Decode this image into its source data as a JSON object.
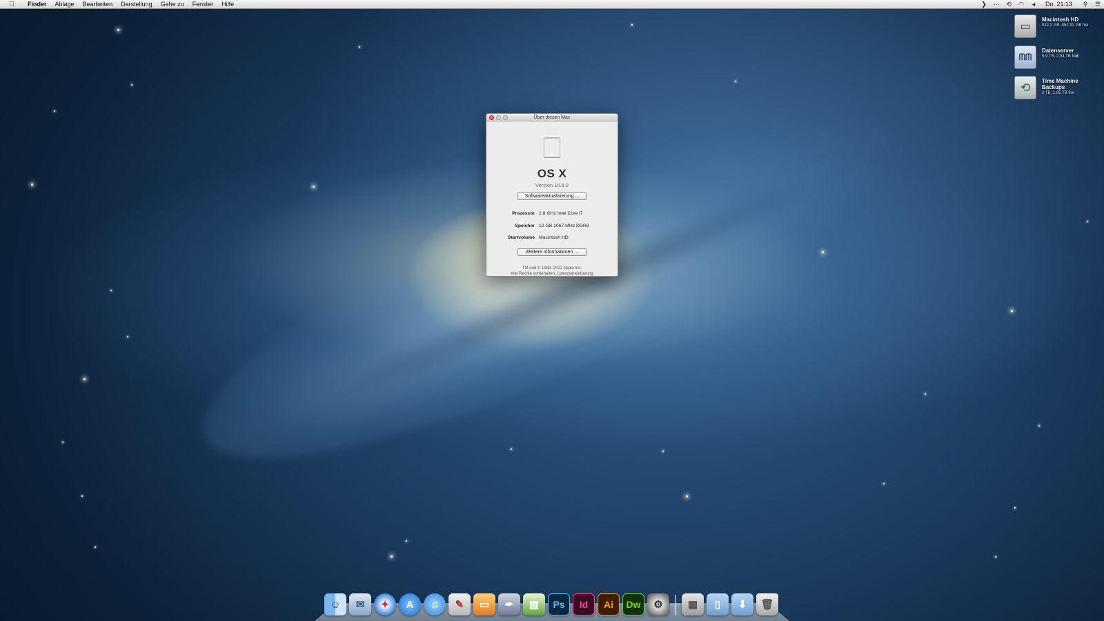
{
  "menubar": {
    "apple_icon": "apple-icon",
    "items": [
      {
        "label": "Finder"
      },
      {
        "label": "Ablage"
      },
      {
        "label": "Bearbeiten"
      },
      {
        "label": "Darstellung"
      },
      {
        "label": "Gehe zu"
      },
      {
        "label": "Fenster"
      },
      {
        "label": "Hilfe"
      }
    ],
    "status_icons": [
      "collapse-arrow-icon",
      "bluetooth-icon",
      "time-machine-icon",
      "wifi-icon",
      "volume-icon"
    ],
    "clock": "Do. 21:13",
    "search_icon": "spotlight-search-icon",
    "notification_icon": "notification-center-icon"
  },
  "desktop_items": [
    {
      "name": "Macintosh HD",
      "sub": "832,2 GB, 852,92 GB frei",
      "icon": "hard-drive-icon"
    },
    {
      "name": "Datenserver",
      "sub": "5,9 TB, 2,94 TB frei",
      "icon": "network-server-icon"
    },
    {
      "name": "Time Machine Backups",
      "sub": "2 TB, 1,95 TB frei",
      "icon": "time-machine-drive-icon"
    }
  ],
  "about_window": {
    "title": "Über diesen Mac",
    "os_name": "OS X",
    "version": "Version 10.8.2",
    "update_button": "Softwareaktualisierung ...",
    "info": [
      {
        "label": "Prozessor",
        "value": "2.8 GHz Intel Core i7"
      },
      {
        "label": "Speicher",
        "value": "12 GB 1067 MHz  DDR3"
      },
      {
        "label": "Startvolume",
        "value": "Macintosh HD"
      }
    ],
    "more_button": "Weitere Informationen ...",
    "legal_line1": "TM und © 1983–2012 Apple Inc.",
    "legal_line2": "Alle Rechte vorbehalten.",
    "license_link": "Lizenzvereinbarung"
  },
  "dock": {
    "apps": [
      {
        "name": "finder-icon",
        "glyph": "☺"
      },
      {
        "name": "mail-icon",
        "glyph": "✉"
      },
      {
        "name": "safari-icon",
        "glyph": "✦"
      },
      {
        "name": "app-store-icon",
        "glyph": "A"
      },
      {
        "name": "itunes-icon",
        "glyph": "♫"
      },
      {
        "name": "script-editor-icon",
        "glyph": "✎"
      },
      {
        "name": "keynote-icon",
        "glyph": "▭"
      },
      {
        "name": "pen-tool-icon",
        "glyph": "✒"
      },
      {
        "name": "numbers-icon",
        "glyph": "▥"
      },
      {
        "name": "photoshop-icon",
        "glyph": "Ps"
      },
      {
        "name": "indesign-icon",
        "glyph": "Id"
      },
      {
        "name": "illustrator-icon",
        "glyph": "Ai"
      },
      {
        "name": "dreamweaver-icon",
        "glyph": "Dw"
      },
      {
        "name": "system-preferences-icon",
        "glyph": "⚙"
      }
    ],
    "stacks": [
      {
        "name": "applications-stack-icon",
        "glyph": "▦"
      },
      {
        "name": "documents-stack-icon",
        "glyph": "▯"
      },
      {
        "name": "downloads-stack-icon",
        "glyph": "⬇"
      },
      {
        "name": "trash-icon",
        "glyph": "🗑"
      }
    ]
  }
}
